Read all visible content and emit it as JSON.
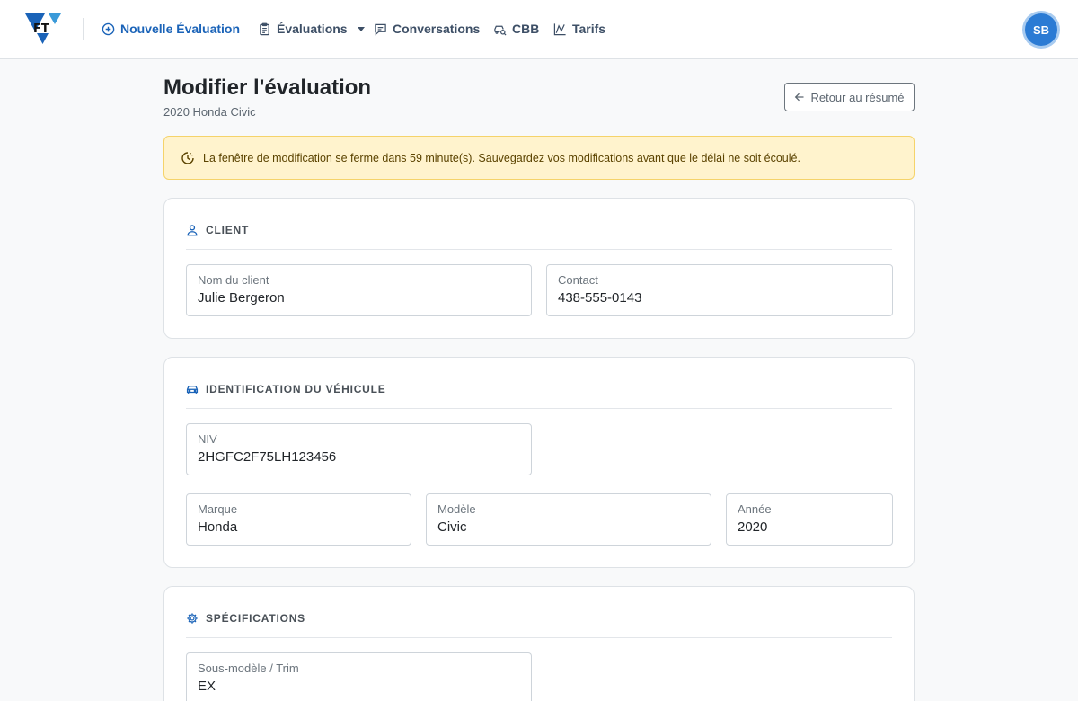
{
  "nav": {
    "logo_text": "FT",
    "new_evaluation": "Nouvelle Évaluation",
    "evaluations": "Évaluations",
    "conversations": "Conversations",
    "cbb": "CBB",
    "tarifs": "Tarifs",
    "avatar_initials": "SB"
  },
  "page": {
    "title": "Modifier l'évaluation",
    "subtitle": "2020 Honda Civic",
    "back_label": "Retour au résumé"
  },
  "alert": {
    "message": "La fenêtre de modification se ferme dans 59 minute(s). Sauvegardez vos modifications avant que le délai ne soit écoulé."
  },
  "client": {
    "title": "CLIENT",
    "name_label": "Nom du client",
    "name_value": "Julie Bergeron",
    "contact_label": "Contact",
    "contact_value": "438-555-0143"
  },
  "vehicle": {
    "title": "IDENTIFICATION DU VÉHICULE",
    "vin_label": "NIV",
    "vin_value": "2HGFC2F75LH123456",
    "make_label": "Marque",
    "make_value": "Honda",
    "model_label": "Modèle",
    "model_value": "Civic",
    "year_label": "Année",
    "year_value": "2020"
  },
  "specs": {
    "title": "SPÉCIFICATIONS",
    "trim_label": "Sous-modèle / Trim",
    "trim_value": "EX"
  },
  "colors": {
    "brand_blue": "#1a63b8",
    "logo_cyan": "#3a9ad9",
    "alert_bg": "#fff3cd",
    "alert_border": "#f5d36a",
    "avatar_bg": "#2b7bd4"
  },
  "icons": {
    "new_evaluation": "plus-circle-icon",
    "evaluations": "clipboard-icon",
    "conversations": "chat-icon",
    "cbb": "car-search-icon",
    "tarifs": "chart-icon",
    "back": "arrow-left-icon",
    "alert": "clock-icon",
    "client": "person-icon",
    "vehicle": "car-icon",
    "specs": "gear-icon"
  }
}
